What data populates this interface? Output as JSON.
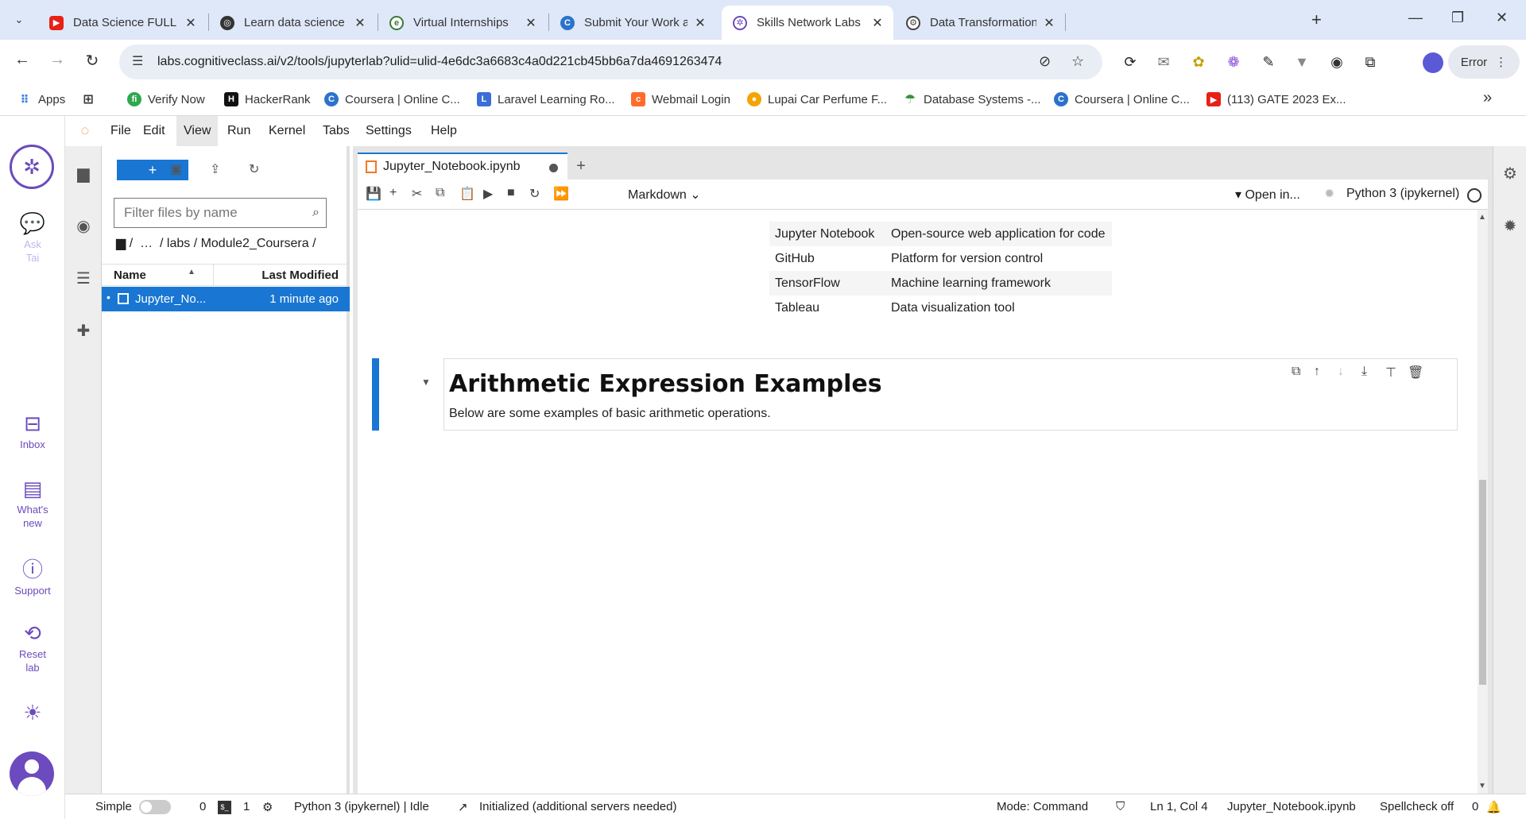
{
  "browser": {
    "tabs": [
      {
        "title": "Data Science FULL Course -",
        "favicon": "youtube-icon",
        "color": "#e62117"
      },
      {
        "title": "Learn data science with Pyt",
        "favicon": "chatbot-icon",
        "color": "#333333"
      },
      {
        "title": "Virtual Internships",
        "favicon": "forage-icon",
        "color": "#3a7a3a"
      },
      {
        "title": "Submit Your Work and Gra",
        "favicon": "coursera-icon",
        "color": "#2a73cc"
      },
      {
        "title": "Skills Network Labs",
        "favicon": "skills-network-icon",
        "color": "#6b4bbd",
        "active": true
      },
      {
        "title": "Data Transformation Categ",
        "favicon": "openai-icon",
        "color": "#444444"
      }
    ],
    "url": "labs.cognitiveclass.ai/v2/tools/jupyterlab?ulid=ulid-4e6dc3a6683c4a0d221cb45bb6a7da4691263474",
    "error_label": "Error",
    "bookmarks": [
      {
        "label": "Apps",
        "icon": "apps-grid-icon",
        "color": "#3b7ddd"
      },
      {
        "label": "Verify Now",
        "icon": "verify-icon",
        "color": "#2fa84f"
      },
      {
        "label": "HackerRank",
        "icon": "hackerrank-icon",
        "color": "#111111"
      },
      {
        "label": "Coursera | Online C...",
        "icon": "coursera-icon",
        "color": "#2a73cc"
      },
      {
        "label": "Laravel Learning Ro...",
        "icon": "laravel-icon",
        "color": "#3b6fd6"
      },
      {
        "label": "Webmail Login",
        "icon": "cpanel-icon",
        "color": "#ff6c2c"
      },
      {
        "label": "Lupai Car Perfume F...",
        "icon": "lupai-icon",
        "color": "#f4a300"
      },
      {
        "label": "Database Systems -...",
        "icon": "database-icon",
        "color": "#3a8f3a"
      },
      {
        "label": "Coursera | Online C...",
        "icon": "coursera-icon",
        "color": "#2a73cc"
      },
      {
        "label": "(113) GATE 2023 Ex...",
        "icon": "youtube-icon",
        "color": "#e62117"
      }
    ]
  },
  "sn_rail": {
    "items": [
      {
        "label": "Ask\nTai",
        "icon": "chat-bubbles-icon"
      },
      {
        "label": "Inbox",
        "icon": "inbox-icon"
      },
      {
        "label": "What's\nnew",
        "icon": "newspaper-icon"
      },
      {
        "label": "Support",
        "icon": "help-icon"
      },
      {
        "label": "Reset\nlab",
        "icon": "reset-icon"
      }
    ]
  },
  "jupyter": {
    "menus": [
      "File",
      "Edit",
      "View",
      "Run",
      "Kernel",
      "Tabs",
      "Settings",
      "Help"
    ],
    "active_menu": "View",
    "filebrowser": {
      "new_label": "+",
      "filter_placeholder": "Filter files by name",
      "crumbs": [
        "/",
        "…",
        "/ labs / Module2_Coursera /"
      ],
      "col_name": "Name",
      "col_modified": "Last Modified",
      "files": [
        {
          "name": "Jupyter_No...",
          "modified": "1 minute ago"
        }
      ]
    },
    "notebook_tab": "Jupyter_Notebook.ipynb",
    "cell_type": "Markdown",
    "open_in": "Open in...",
    "kernel": "Python 3 (ipykernel)",
    "table_rows": [
      {
        "tool": "Jupyter Notebook",
        "desc": "Open-source web application for code"
      },
      {
        "tool": "GitHub",
        "desc": "Platform for version control"
      },
      {
        "tool": "TensorFlow",
        "desc": "Machine learning framework"
      },
      {
        "tool": "Tableau",
        "desc": "Data visualization tool"
      }
    ],
    "cell": {
      "heading": "Arithmetic Expression Examples",
      "text": "Below are some examples of basic arithmetic operations."
    },
    "statusbar": {
      "simple": "Simple",
      "count_a": "0",
      "count_b": "1",
      "kernel_state": "Python 3 (ipykernel) | Idle",
      "init": "Initialized (additional servers needed)",
      "mode": "Mode: Command",
      "position": "Ln 1, Col 4",
      "file": "Jupyter_Notebook.ipynb",
      "spellcheck": "Spellcheck off",
      "notifications": "0"
    }
  },
  "colors": {
    "accent": "#1976d2",
    "brand": "#6b4bbd",
    "jupyter_orange": "#f37726"
  }
}
